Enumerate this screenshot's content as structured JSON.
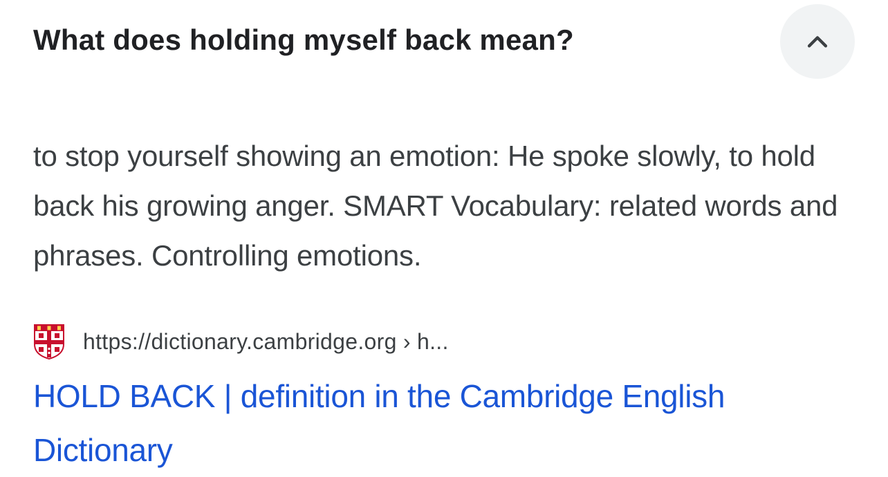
{
  "question": {
    "title": "What does holding myself back mean?",
    "expand_icon": "chevron-up-icon"
  },
  "answer": {
    "text": "to stop yourself showing an emotion: He spoke slowly, to hold back his growing anger. SMART Vocabulary: related words and phrases. Controlling emotions."
  },
  "source": {
    "favicon_icon": "cambridge-crest-icon",
    "url": "https://dictionary.cambridge.org › h...",
    "link_title": "HOLD BACK | definition in the Cambridge English Dictionary"
  },
  "colors": {
    "title": "#202124",
    "body_text": "#3c4043",
    "link": "#1a55d6",
    "button_bg": "#f1f3f4"
  }
}
